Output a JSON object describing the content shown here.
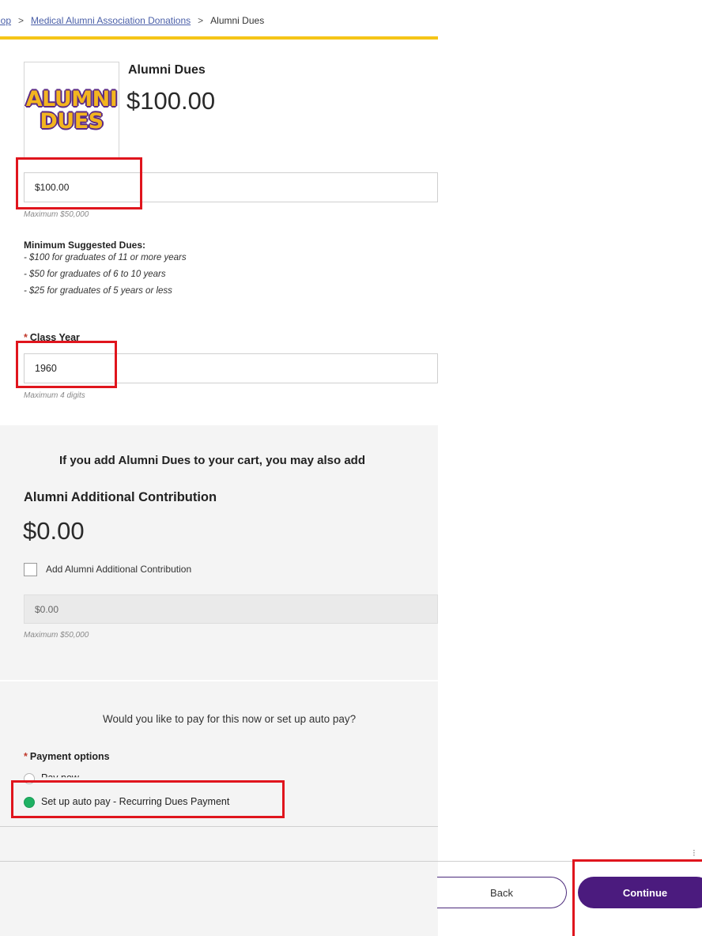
{
  "breadcrumb": {
    "shop": "Shop",
    "category": "Medical Alumni Association Donations",
    "current": "Alumni Dues",
    "separator": ">"
  },
  "product": {
    "logo_line1": "ALUMNI",
    "logo_line2": "DUES",
    "name": "Alumni Dues",
    "price": "$100.00"
  },
  "amount": {
    "value": "$100.00",
    "hint": "Maximum $50,000"
  },
  "suggested": {
    "title": "Minimum Suggested Dues:",
    "lines": [
      "- $100 for graduates of 11 or more years",
      "- $50 for graduates of 6 to 10 years",
      "- $25 for graduates of 5 years or less"
    ]
  },
  "class_year": {
    "required_mark": "*",
    "label": "Class Year",
    "value": "1960",
    "hint": "Maximum 4 digits"
  },
  "addon": {
    "heading": "If you add Alumni Dues to your cart, you may also add",
    "name": "Alumni Additional Contribution",
    "price": "$0.00",
    "checkbox_label": "Add Alumni Additional Contribution",
    "input_value": "$0.00",
    "hint": "Maximum $50,000"
  },
  "payment": {
    "question": "Would you like to pay for this now or set up auto pay?",
    "required_mark": "*",
    "label": "Payment options",
    "option_pay_now": "Pay now",
    "option_auto": "Set up auto pay - Recurring Dues Payment",
    "selected": "auto"
  },
  "buttons": {
    "back": "Back",
    "continue": "Continue"
  },
  "colors": {
    "gold": "#f5c518",
    "purple": "#4b1b7e",
    "highlight_red": "#e0151d",
    "radio_green": "#1fb163"
  }
}
